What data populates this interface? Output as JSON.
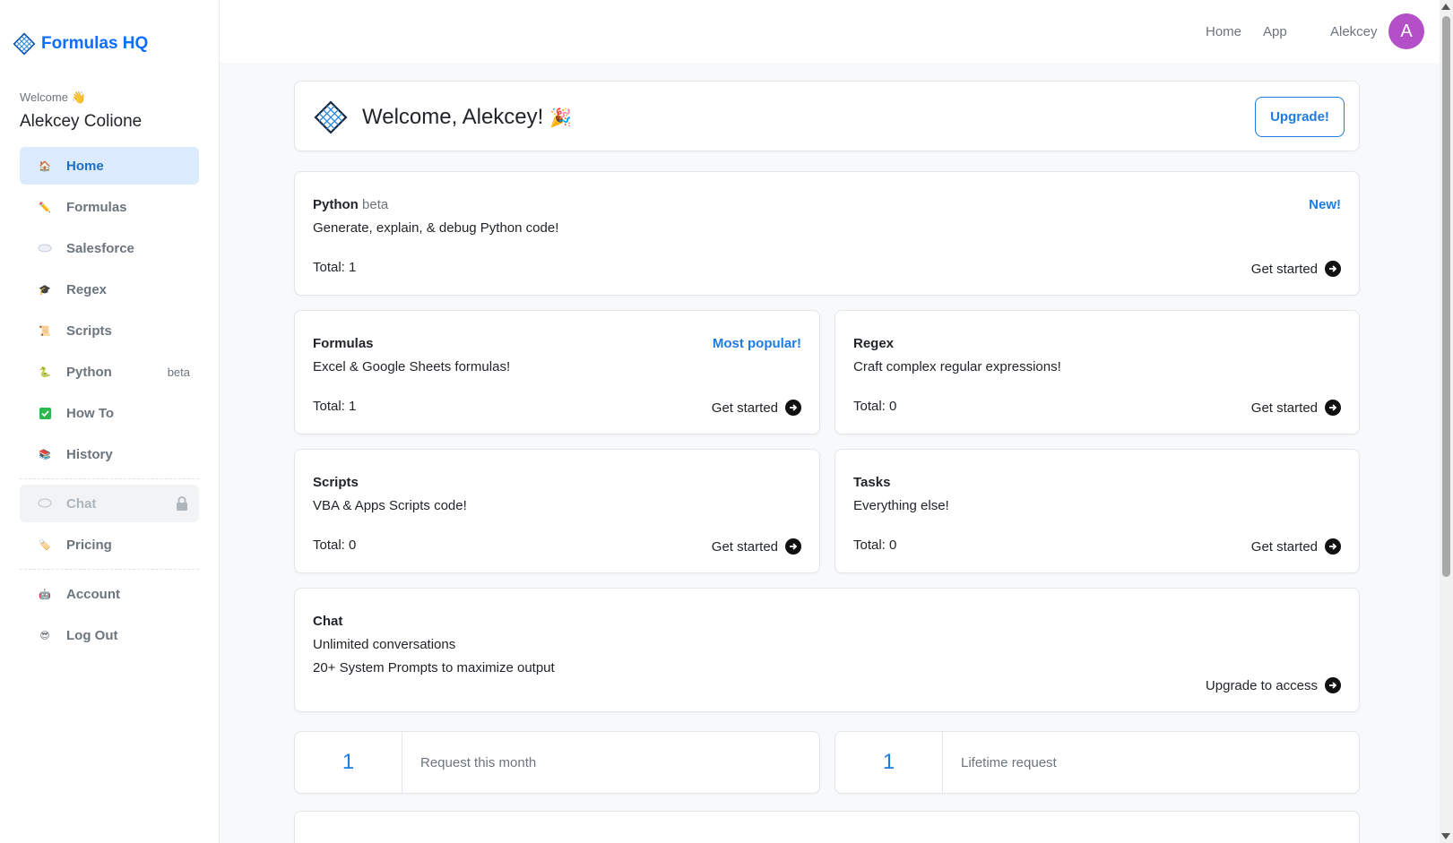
{
  "brand": {
    "name": "Formulas HQ",
    "color": "#0d6efd",
    "icon": "grid-diamond-logo-icon"
  },
  "sidebar": {
    "welcome_label": "Welcome 👋",
    "user_name": "Alekcey Colione",
    "items": [
      {
        "label": "Home",
        "icon": "house-icon",
        "emoji": "🏠",
        "active": true
      },
      {
        "label": "Formulas",
        "icon": "pencil-icon",
        "emoji": "✏️"
      },
      {
        "label": "Salesforce",
        "icon": "cloud-icon",
        "emoji": "☁️"
      },
      {
        "label": "Regex",
        "icon": "grad-cap-icon",
        "emoji": "🎓"
      },
      {
        "label": "Scripts",
        "icon": "scroll-icon",
        "emoji": "📜"
      },
      {
        "label": "Python",
        "icon": "snake-icon",
        "emoji": "🐍",
        "badge": "beta"
      },
      {
        "label": "How To",
        "icon": "check-box-icon",
        "emoji": "✅"
      },
      {
        "label": "History",
        "icon": "books-icon",
        "emoji": "📚"
      }
    ],
    "chat": {
      "label": "Chat",
      "icon": "speech-bubble-icon",
      "locked": true
    },
    "pricing": {
      "label": "Pricing",
      "icon": "tag-icon"
    },
    "account": {
      "label": "Account",
      "icon": "robot-icon"
    },
    "logout": {
      "label": "Log Out",
      "icon": "sunglasses-face-icon"
    }
  },
  "topbar": {
    "home": "Home",
    "app": "App",
    "user": "Alekcey",
    "avatar_letter": "A",
    "avatar_color": "#b350c8"
  },
  "welcome": {
    "title": "Welcome, Alekcey!",
    "upgrade_label": "Upgrade!"
  },
  "cards": {
    "python": {
      "name": "Python",
      "tag": "beta",
      "flag": "New!",
      "desc": "Generate, explain, & debug Python code!",
      "total": "Total: 1",
      "cta": "Get started"
    },
    "formulas": {
      "name": "Formulas",
      "flag": "Most popular!",
      "desc": "Excel & Google Sheets formulas!",
      "total": "Total: 1",
      "cta": "Get started"
    },
    "regex": {
      "name": "Regex",
      "desc": "Craft complex regular expressions!",
      "total": "Total: 0",
      "cta": "Get started"
    },
    "scripts": {
      "name": "Scripts",
      "desc": "VBA & Apps Scripts code!",
      "total": "Total: 0",
      "cta": "Get started"
    },
    "tasks": {
      "name": "Tasks",
      "desc": "Everything else!",
      "total": "Total: 0",
      "cta": "Get started"
    },
    "chat": {
      "name": "Chat",
      "desc": "Unlimited conversations",
      "desc2": "20+ System Prompts to maximize output",
      "cta": "Upgrade to access"
    }
  },
  "stats": [
    {
      "value": "1",
      "label": "Request this month"
    },
    {
      "value": "1",
      "label": "Lifetime request"
    }
  ],
  "accent": "#1e7be0"
}
